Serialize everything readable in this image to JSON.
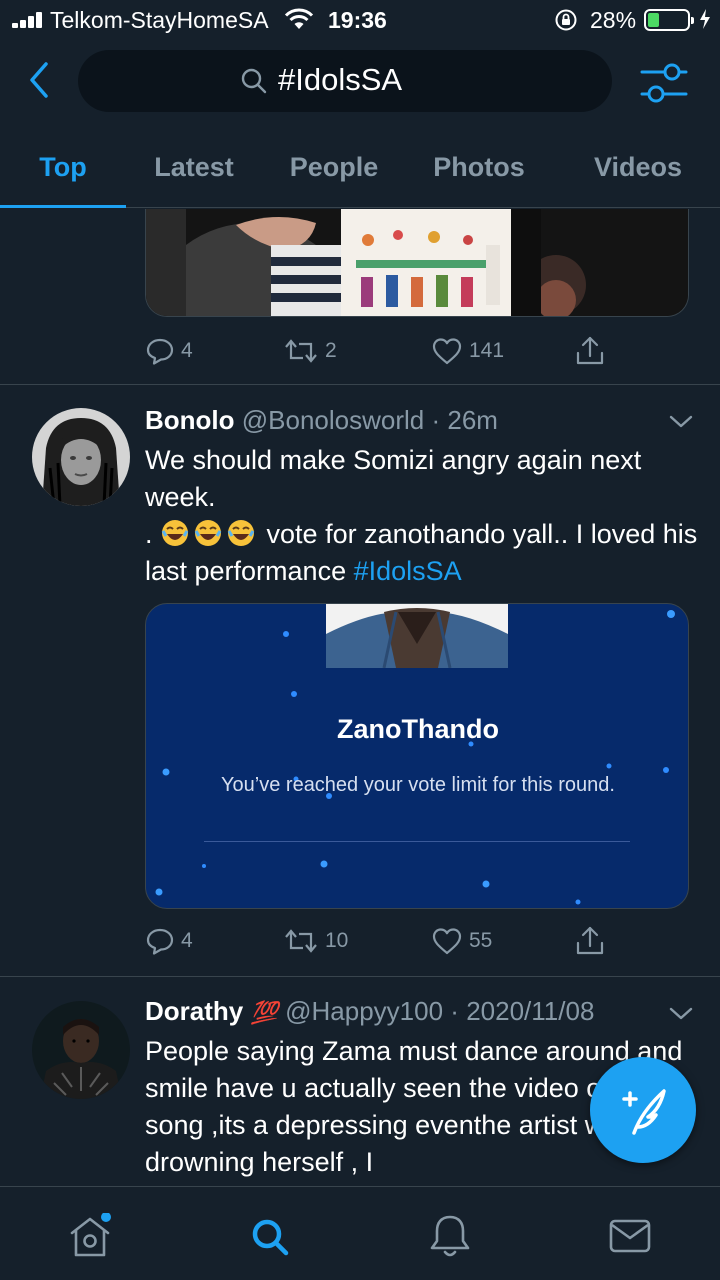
{
  "status_bar": {
    "carrier": "Telkom-StayHomeSA",
    "time": "19:36",
    "battery_percent": "28%",
    "battery_level": 0.28
  },
  "search": {
    "query": "#IdolsSA",
    "back_icon": "chevron-left-icon",
    "filter_icon": "sliders-icon"
  },
  "tabs": [
    {
      "label": "Top",
      "active": true
    },
    {
      "label": "Latest",
      "active": false
    },
    {
      "label": "People",
      "active": false
    },
    {
      "label": "Photos",
      "active": false
    },
    {
      "label": "Videos",
      "active": false
    }
  ],
  "tweets": [
    {
      "replies": "4",
      "retweets": "2",
      "likes": "141"
    },
    {
      "name": "Bonolo",
      "handle": "@Bonolosworld",
      "separator": "·",
      "time": "26m",
      "text_line1": "We should make Somizi angry again next week.",
      "text_line2_prefix": ".",
      "text_line2_suffix": " vote for zanothando yall.. I loved his last performance",
      "hashtag": "#IdolsSA",
      "card": {
        "title": "ZanoThando",
        "subtitle": "You’ve reached your vote limit for this round."
      },
      "replies": "4",
      "retweets": "10",
      "likes": "55"
    },
    {
      "name": "Dorathy",
      "badge": "💯",
      "handle": "@Happyy100",
      "separator": "·",
      "time": "2020/11/08",
      "text": "People saying Zama must dance around and smile have u actually seen the video of that song ,its a depressing eventhe artist was drowning herself , I"
    }
  ],
  "bottom_nav": [
    {
      "icon": "home-icon",
      "active": false,
      "notification_dot": true
    },
    {
      "icon": "search-icon",
      "active": true
    },
    {
      "icon": "bell-icon",
      "active": false
    },
    {
      "icon": "mail-icon",
      "active": false
    }
  ],
  "colors": {
    "background": "#15202b",
    "accent": "#1da1f2",
    "secondary_text": "#8899a6",
    "divider": "#38444d"
  }
}
